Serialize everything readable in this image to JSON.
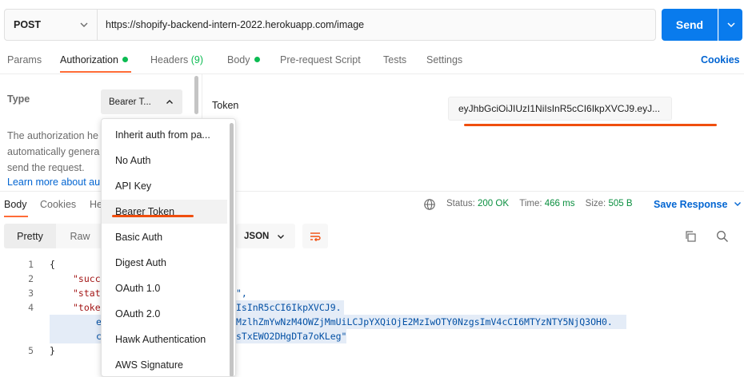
{
  "request": {
    "method": "POST",
    "url": "https://shopify-backend-intern-2022.herokuapp.com/image",
    "send_label": "Send"
  },
  "tabs": {
    "params": "Params",
    "authorization": "Authorization",
    "headers": "Headers",
    "headers_count": "(9)",
    "body": "Body",
    "prerequest": "Pre-request Script",
    "tests": "Tests",
    "settings": "Settings",
    "cookies": "Cookies"
  },
  "auth": {
    "type_label": "Type",
    "type_value": "Bearer T...",
    "description_lines": [
      "The authorization he",
      "automatically genera",
      "send the request."
    ],
    "learn_more": "Learn more about au",
    "token_label": "Token",
    "token_value": "eyJhbGciOiJIUzI1NiIsInR5cCI6IkpXVCJ9.eyJ..."
  },
  "dropdown": {
    "items": [
      "Inherit auth from pa...",
      "No Auth",
      "API Key",
      "Bearer Token",
      "Basic Auth",
      "Digest Auth",
      "OAuth 1.0",
      "OAuth 2.0",
      "Hawk Authentication",
      "AWS Signature"
    ],
    "selected": "Bearer Token"
  },
  "response": {
    "tabs": {
      "body": "Body",
      "cookies": "Cookies",
      "headers": "He"
    },
    "status_label": "Status:",
    "status_value": "200 OK",
    "time_label": "Time:",
    "time_value": "466 ms",
    "size_label": "Size:",
    "size_value": "505 B",
    "save_response": "Save Response",
    "view": {
      "pretty": "Pretty",
      "raw": "Raw",
      "format": "JSON"
    }
  },
  "code": {
    "line_numbers": [
      "1",
      "2",
      "3",
      "4",
      "5"
    ],
    "brace_open": "{",
    "brace_close": "}",
    "l2": "\"succ",
    "l3": "\"stat",
    "l4": "\"toke",
    "l5a": "e",
    "l5b": "c",
    "r3": "\",",
    "r4": "IsInR5cCI6IkpXVCJ9.",
    "r5": "MzlhZmYwNzM4OWZjMmUiLCJpYXQiOjE2MzIwOTY0NzgsImV4cCI6MTYzNTY5NjQ3OH0.",
    "r6": "sTxEWO2DHgDTa7oKLeg\""
  },
  "colors": {
    "accent_orange": "#ff6c37",
    "annotation_red": "#f04e0e",
    "send_blue": "#097bed",
    "link_blue": "#0265d2",
    "status_green": "#0cbb52"
  },
  "icons": {
    "method_chevron": "chevron-down-icon",
    "send_chevron": "chevron-down-icon",
    "type_chevron": "chevron-up-icon",
    "globe": "globe-icon",
    "copy": "copy-icon",
    "search": "search-icon",
    "wrap": "wrap-lines-icon"
  }
}
